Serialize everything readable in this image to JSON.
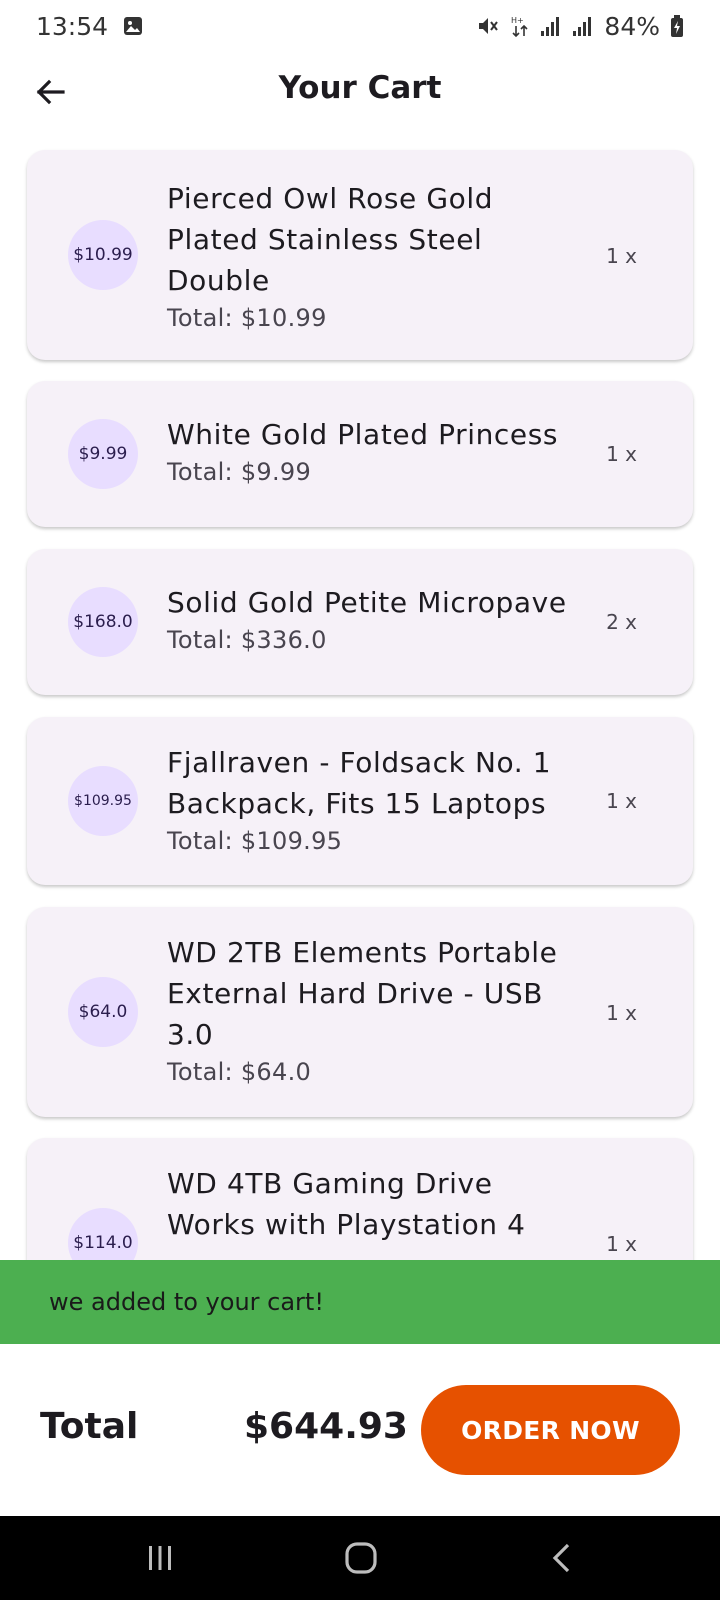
{
  "status_bar": {
    "time": "13:54",
    "battery": "84%",
    "icons": [
      "image-icon",
      "mute-icon",
      "data-arrows-icon",
      "signal-icon",
      "signal-icon",
      "battery-charging-icon"
    ]
  },
  "app_bar": {
    "title": "Your Cart",
    "back_icon": "arrow-left-icon"
  },
  "cart": {
    "items": [
      {
        "price": "$10.99",
        "name": "Pierced Owl Rose Gold Plated Stainless Steel Double",
        "total": "Total: $10.99",
        "qty": "1 x"
      },
      {
        "price": "$9.99",
        "name": "White Gold Plated Princess",
        "total": "Total: $9.99",
        "qty": "1 x"
      },
      {
        "price": "$168.0",
        "name": "Solid Gold Petite Micropave",
        "total": "Total: $336.0",
        "qty": "2 x"
      },
      {
        "price": "$109.95",
        "name": "Fjallraven - Foldsack No. 1 Backpack, Fits 15 Laptops",
        "total": "Total: $109.95",
        "qty": "1 x"
      },
      {
        "price": "$64.0",
        "name": "WD 2TB Elements Portable External Hard Drive - USB 3.0",
        "total": "Total: $64.0",
        "qty": "1 x"
      },
      {
        "price": "$114.0",
        "name": "WD 4TB Gaming Drive Works with Playstation 4",
        "total": "",
        "qty": "1 x"
      }
    ]
  },
  "snackbar": {
    "message": "we added to your cart!",
    "color": "#4caf50"
  },
  "checkout": {
    "total_label": "Total",
    "total_amount": "$644.93",
    "order_button": "ORDER NOW",
    "accent": "#e65100"
  },
  "nav_bar": {
    "icons": [
      "recent-apps-icon",
      "home-icon",
      "back-icon"
    ]
  }
}
